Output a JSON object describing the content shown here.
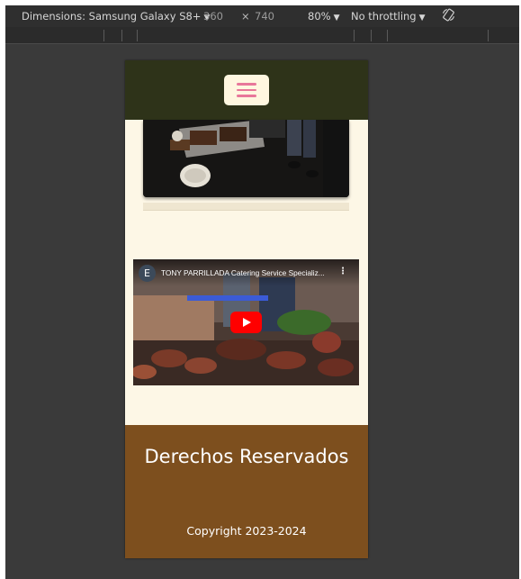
{
  "devtools": {
    "dimensions_label": "Dimensions: Samsung Galaxy S8+",
    "width_value": "360",
    "times": "×",
    "height_value": "740",
    "zoom": "80%",
    "throttling": "No throttling",
    "caret": "▼",
    "rotate_icon": "rotate-icon"
  },
  "page": {
    "nav": {
      "menu_icon": "hamburger-menu-icon",
      "accent": "#e8779a",
      "background": "#2e3319"
    },
    "video": {
      "channel_initial": "E",
      "title": "TONY PARRILLADA Catering Service Specializ...",
      "more_icon": "⋮",
      "play_icon": "play-icon",
      "play_color": "#ff0000"
    },
    "footer": {
      "title": "Derechos Reservados",
      "copyright": "Copyright 2023-2024",
      "background": "#7d4f1e"
    },
    "background": "#fdf7e6"
  }
}
